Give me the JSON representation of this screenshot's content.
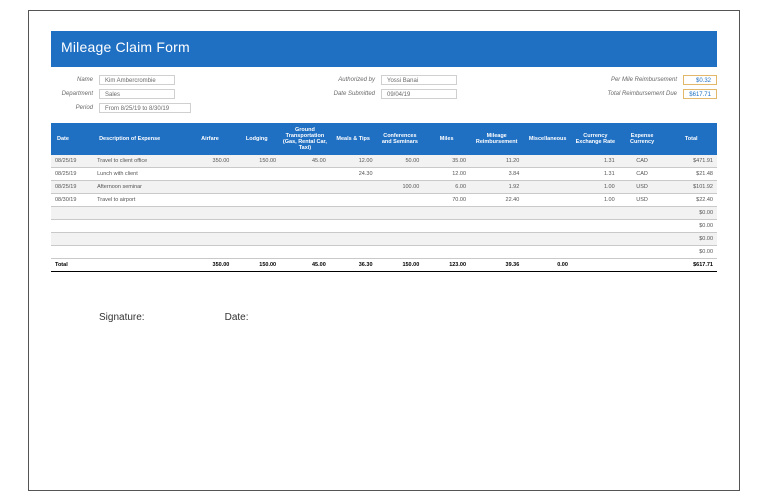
{
  "title": "Mileage Claim Form",
  "meta": {
    "name_label": "Name",
    "name_value": "Kim Ambercrombie",
    "department_label": "Department",
    "department_value": "Sales",
    "period_label": "Period",
    "period_value": "From 8/25/19 to 8/30/19",
    "authorized_label": "Authorized by",
    "authorized_value": "Yossi Banai",
    "date_submitted_label": "Date Submitted",
    "date_submitted_value": "09/04/19",
    "per_mile_label": "Per Mile Reimbursement",
    "per_mile_value": "$0.32",
    "total_due_label": "Total Reimbursement Due",
    "total_due_value": "$617.71"
  },
  "headers": {
    "date": "Date",
    "desc": "Description of Expense",
    "airfare": "Airfare",
    "lodging": "Lodging",
    "ground": "Ground Transportation (Gas, Rental Car, Taxi)",
    "meals": "Meals & Tips",
    "conf": "Conferences and Seminars",
    "miles": "Miles",
    "mileage": "Mileage Reimbursement",
    "misc": "Miscellaneous",
    "rate": "Currency Exchange Rate",
    "curr": "Expense Currency",
    "total": "Total"
  },
  "rows": [
    {
      "date": "08/25/19",
      "desc": "Travel to client office",
      "airfare": "350.00",
      "lodging": "150.00",
      "ground": "45.00",
      "meals": "12.00",
      "conf": "50.00",
      "miles": "35.00",
      "mileage": "11.20",
      "misc": "",
      "rate": "1.31",
      "curr": "CAD",
      "total": "$471.91"
    },
    {
      "date": "08/25/19",
      "desc": "Lunch with client",
      "airfare": "",
      "lodging": "",
      "ground": "",
      "meals": "24.30",
      "conf": "",
      "miles": "12.00",
      "mileage": "3.84",
      "misc": "",
      "rate": "1.31",
      "curr": "CAD",
      "total": "$21.48"
    },
    {
      "date": "08/25/19",
      "desc": "Afternoon seminar",
      "airfare": "",
      "lodging": "",
      "ground": "",
      "meals": "",
      "conf": "100.00",
      "miles": "6.00",
      "mileage": "1.92",
      "misc": "",
      "rate": "1.00",
      "curr": "USD",
      "total": "$101.92"
    },
    {
      "date": "08/30/19",
      "desc": "Travel to airport",
      "airfare": "",
      "lodging": "",
      "ground": "",
      "meals": "",
      "conf": "",
      "miles": "70.00",
      "mileage": "22.40",
      "misc": "",
      "rate": "1.00",
      "curr": "USD",
      "total": "$22.40"
    }
  ],
  "empty_total": "$0.00",
  "totals": {
    "label": "Total",
    "airfare": "350.00",
    "lodging": "150.00",
    "ground": "45.00",
    "meals": "36.30",
    "conf": "150.00",
    "miles": "123.00",
    "mileage": "39.36",
    "misc": "0.00",
    "total": "$617.71"
  },
  "signature_label": "Signature:",
  "date_label": "Date:"
}
